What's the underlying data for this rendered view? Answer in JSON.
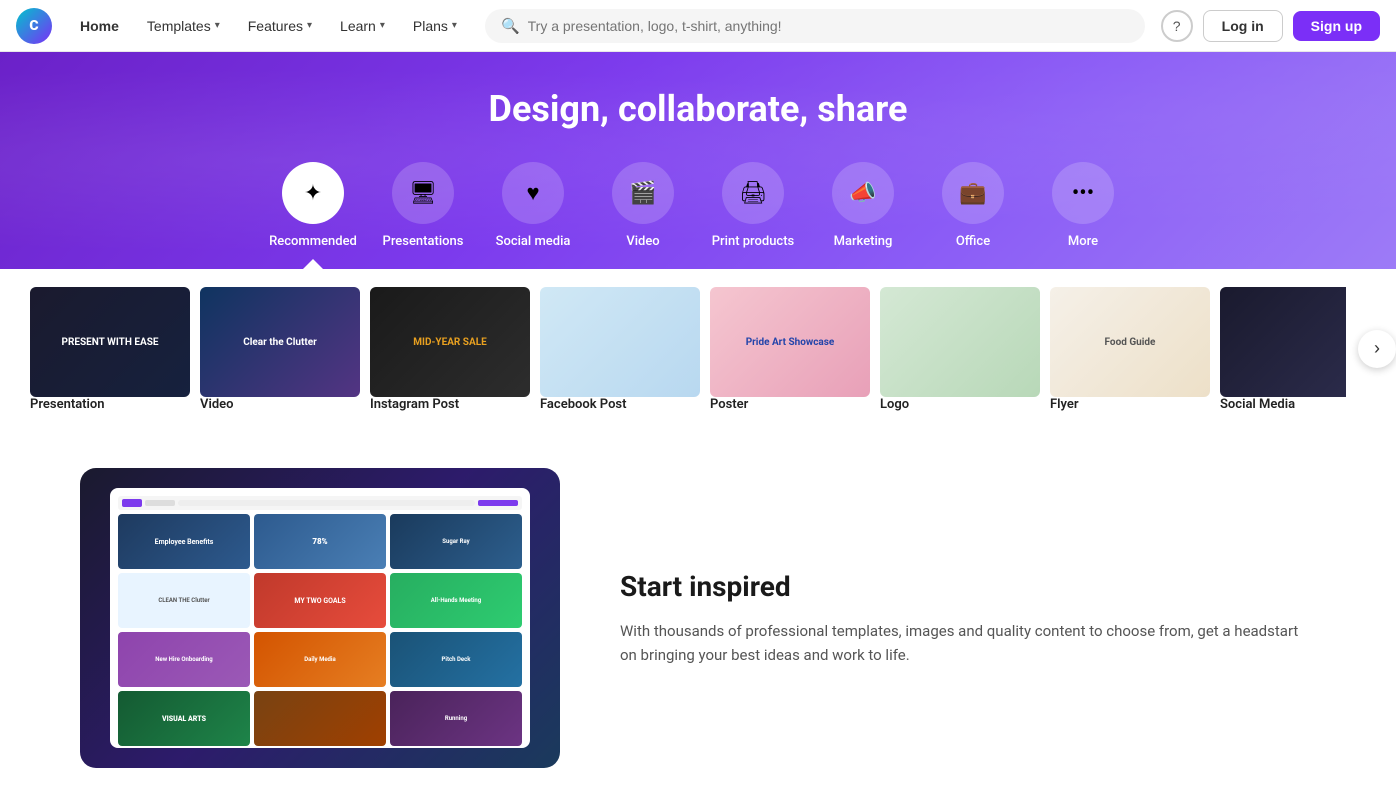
{
  "brand": {
    "name": "Canva",
    "logo_text": "C"
  },
  "navbar": {
    "home_label": "Home",
    "templates_label": "Templates",
    "features_label": "Features",
    "learn_label": "Learn",
    "plans_label": "Plans",
    "search_placeholder": "Try a presentation, logo, t-shirt, anything!",
    "help_icon": "?",
    "login_label": "Log in",
    "signup_label": "Sign up"
  },
  "hero": {
    "title": "Design, collaborate, share"
  },
  "categories": [
    {
      "id": "recommended",
      "label": "Recommended",
      "icon": "✦",
      "selected": true
    },
    {
      "id": "presentations",
      "label": "Presentations",
      "icon": "🖥",
      "selected": false
    },
    {
      "id": "social-media",
      "label": "Social media",
      "icon": "♥",
      "selected": false
    },
    {
      "id": "video",
      "label": "Video",
      "icon": "🎬",
      "selected": false
    },
    {
      "id": "print-products",
      "label": "Print products",
      "icon": "🖨",
      "selected": false
    },
    {
      "id": "marketing",
      "label": "Marketing",
      "icon": "📣",
      "selected": false
    },
    {
      "id": "office",
      "label": "Office",
      "icon": "💼",
      "selected": false
    },
    {
      "id": "more",
      "label": "More",
      "icon": "•••",
      "selected": false
    }
  ],
  "templates": [
    {
      "label": "Presentation",
      "color1": "#1a1a2e",
      "color2": "#16213e",
      "text": "PRESENT WITH EASE"
    },
    {
      "label": "Video",
      "color1": "#0f3460",
      "color2": "#533483",
      "text": "Clear the Clutter"
    },
    {
      "label": "Instagram Post",
      "color1": "#1a1a1a",
      "color2": "#2d2d2d",
      "text": "MID-YEAR SALE"
    },
    {
      "label": "Facebook Post",
      "color1": "#d0e8f5",
      "color2": "#b8d8f0",
      "text": ""
    },
    {
      "label": "Poster",
      "color1": "#f5c6d0",
      "color2": "#e8a0b8",
      "text": "Pride Art Showcase"
    },
    {
      "label": "Logo",
      "color1": "#d4e8d4",
      "color2": "#b8d8b8",
      "text": ""
    },
    {
      "label": "Flyer",
      "color1": "#f5f0e8",
      "color2": "#ede0c8",
      "text": "Food Guide"
    },
    {
      "label": "Social Media",
      "color1": "#1a1a2e",
      "color2": "#2d2d4e",
      "text": ""
    }
  ],
  "inspired_section": {
    "title": "Start inspired",
    "description": "With thousands of professional templates, images and quality content to choose from, get a headstart on bringing your best ideas and work to life."
  }
}
